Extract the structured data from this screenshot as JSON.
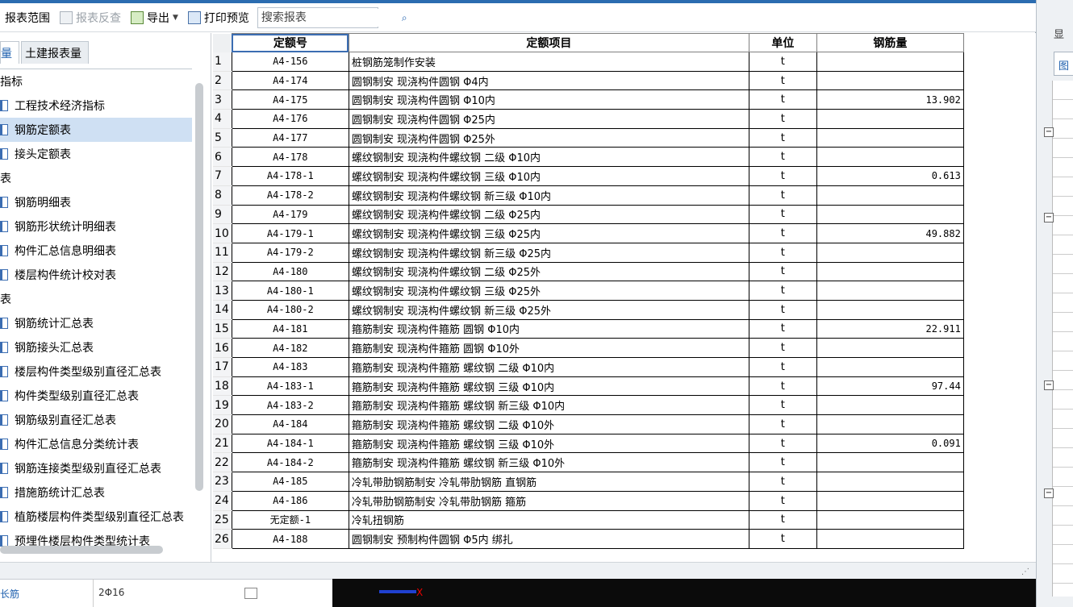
{
  "toolbar": {
    "scope_label": "报表范围",
    "review_label": "报表反查",
    "export_label": "导出",
    "print_preview_label": "打印预览",
    "search_placeholder": "搜索报表"
  },
  "tabs": [
    {
      "label": "量",
      "active": true
    },
    {
      "label": "土建报表量",
      "active": false
    }
  ],
  "tree": [
    {
      "type": "cat",
      "label": "指标"
    },
    {
      "type": "item",
      "label": "工程技术经济指标"
    },
    {
      "type": "item",
      "label": "钢筋定额表",
      "selected": true
    },
    {
      "type": "item",
      "label": "接头定额表"
    },
    {
      "type": "cat",
      "label": "表"
    },
    {
      "type": "item",
      "label": "钢筋明细表"
    },
    {
      "type": "item",
      "label": "钢筋形状统计明细表"
    },
    {
      "type": "item",
      "label": "构件汇总信息明细表"
    },
    {
      "type": "item",
      "label": "楼层构件统计校对表"
    },
    {
      "type": "cat",
      "label": "表"
    },
    {
      "type": "item",
      "label": "钢筋统计汇总表"
    },
    {
      "type": "item",
      "label": "钢筋接头汇总表"
    },
    {
      "type": "item",
      "label": "楼层构件类型级别直径汇总表"
    },
    {
      "type": "item",
      "label": "构件类型级别直径汇总表"
    },
    {
      "type": "item",
      "label": "钢筋级别直径汇总表"
    },
    {
      "type": "item",
      "label": "构件汇总信息分类统计表"
    },
    {
      "type": "item",
      "label": "钢筋连接类型级别直径汇总表"
    },
    {
      "type": "item",
      "label": "措施筋统计汇总表"
    },
    {
      "type": "item",
      "label": "植筋楼层构件类型级别直径汇总表"
    },
    {
      "type": "item",
      "label": "预埋件楼层构件类型统计表"
    }
  ],
  "table": {
    "headers": {
      "code": "定额号",
      "item": "定额项目",
      "unit": "单位",
      "amount": "钢筋量"
    },
    "rows": [
      {
        "n": "1",
        "code": "A4-156",
        "item": "桩钢筋笼制作安装",
        "unit": "t",
        "amount": ""
      },
      {
        "n": "2",
        "code": "A4-174",
        "item": "圆钢制安 现浇构件圆钢 Φ4内",
        "unit": "t",
        "amount": ""
      },
      {
        "n": "3",
        "code": "A4-175",
        "item": "圆钢制安 现浇构件圆钢 Φ10内",
        "unit": "t",
        "amount": "13.902"
      },
      {
        "n": "4",
        "code": "A4-176",
        "item": "圆钢制安 现浇构件圆钢 Φ25内",
        "unit": "t",
        "amount": ""
      },
      {
        "n": "5",
        "code": "A4-177",
        "item": "圆钢制安 现浇构件圆钢 Φ25外",
        "unit": "t",
        "amount": ""
      },
      {
        "n": "6",
        "code": "A4-178",
        "item": "螺纹钢制安 现浇构件螺纹钢 二级 Φ10内",
        "unit": "t",
        "amount": ""
      },
      {
        "n": "7",
        "code": "A4-178-1",
        "item": "螺纹钢制安 现浇构件螺纹钢 三级 Φ10内",
        "unit": "t",
        "amount": "0.613"
      },
      {
        "n": "8",
        "code": "A4-178-2",
        "item": "螺纹钢制安 现浇构件螺纹钢 新三级 Φ10内",
        "unit": "t",
        "amount": ""
      },
      {
        "n": "9",
        "code": "A4-179",
        "item": "螺纹钢制安 现浇构件螺纹钢 二级 Φ25内",
        "unit": "t",
        "amount": ""
      },
      {
        "n": "10",
        "code": "A4-179-1",
        "item": "螺纹钢制安 现浇构件螺纹钢 三级 Φ25内",
        "unit": "t",
        "amount": "49.882"
      },
      {
        "n": "11",
        "code": "A4-179-2",
        "item": "螺纹钢制安 现浇构件螺纹钢 新三级 Φ25内",
        "unit": "t",
        "amount": ""
      },
      {
        "n": "12",
        "code": "A4-180",
        "item": "螺纹钢制安 现浇构件螺纹钢 二级 Φ25外",
        "unit": "t",
        "amount": ""
      },
      {
        "n": "13",
        "code": "A4-180-1",
        "item": "螺纹钢制安 现浇构件螺纹钢 三级 Φ25外",
        "unit": "t",
        "amount": ""
      },
      {
        "n": "14",
        "code": "A4-180-2",
        "item": "螺纹钢制安 现浇构件螺纹钢 新三级 Φ25外",
        "unit": "t",
        "amount": ""
      },
      {
        "n": "15",
        "code": "A4-181",
        "item": "箍筋制安 现浇构件箍筋 圆钢 Φ10内",
        "unit": "t",
        "amount": "22.911"
      },
      {
        "n": "16",
        "code": "A4-182",
        "item": "箍筋制安 现浇构件箍筋 圆钢 Φ10外",
        "unit": "t",
        "amount": ""
      },
      {
        "n": "17",
        "code": "A4-183",
        "item": "箍筋制安 现浇构件箍筋 螺纹钢 二级 Φ10内",
        "unit": "t",
        "amount": ""
      },
      {
        "n": "18",
        "code": "A4-183-1",
        "item": "箍筋制安 现浇构件箍筋 螺纹钢  三级 Φ10内",
        "unit": "t",
        "amount": "97.44"
      },
      {
        "n": "19",
        "code": "A4-183-2",
        "item": "箍筋制安 现浇构件箍筋 螺纹钢  新三级 Φ10内",
        "unit": "t",
        "amount": ""
      },
      {
        "n": "20",
        "code": "A4-184",
        "item": "箍筋制安 现浇构件箍筋 螺纹钢 二级 Φ10外",
        "unit": "t",
        "amount": ""
      },
      {
        "n": "21",
        "code": "A4-184-1",
        "item": "箍筋制安 现浇构件箍筋 螺纹钢 三级 Φ10外",
        "unit": "t",
        "amount": "0.091"
      },
      {
        "n": "22",
        "code": "A4-184-2",
        "item": "箍筋制安 现浇构件箍筋 螺纹钢 新三级 Φ10外",
        "unit": "t",
        "amount": ""
      },
      {
        "n": "23",
        "code": "A4-185",
        "item": "冷轧带肋钢筋制安 冷轧带肋钢筋 直钢筋",
        "unit": "t",
        "amount": ""
      },
      {
        "n": "24",
        "code": "A4-186",
        "item": "冷轧带肋钢筋制安 冷轧带肋钢筋 箍筋",
        "unit": "t",
        "amount": ""
      },
      {
        "n": "25",
        "code": "无定额-1",
        "item": "冷轧扭钢筋",
        "unit": "t",
        "amount": ""
      },
      {
        "n": "26",
        "code": "A4-188",
        "item": "圆钢制安 预制构件圆钢 Φ5内 绑扎",
        "unit": "t",
        "amount": ""
      }
    ]
  },
  "background": {
    "right_tab_1": "显",
    "right_tab_2": "图",
    "bottom_label": "长筋",
    "bottom_value": "2Φ16",
    "axis_label": "X"
  }
}
